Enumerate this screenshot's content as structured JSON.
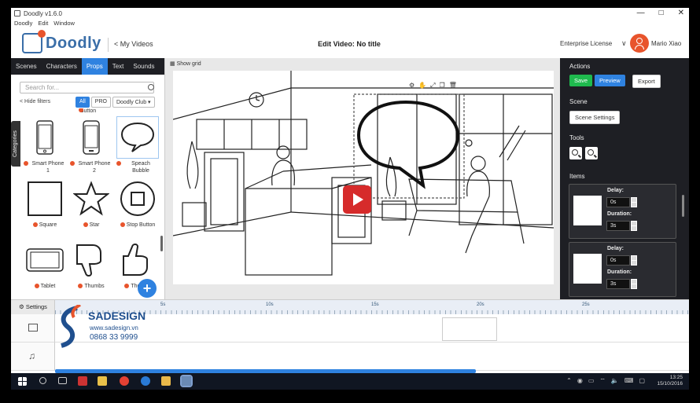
{
  "window": {
    "title": "Doodly v1.6.0",
    "controls": [
      "—",
      "□",
      "✕"
    ]
  },
  "menu": [
    "Doodly",
    "Edit",
    "Window"
  ],
  "header": {
    "logo": "Doodly",
    "back_link": "< My Videos",
    "edit_title": "Edit Video: No title",
    "license": "Enterprise License",
    "chevron": "∨",
    "user": "Mario Xiao"
  },
  "left": {
    "tabs": [
      "Scenes",
      "Characters",
      "Props",
      "Text",
      "Sounds"
    ],
    "active_tab": "Props",
    "search_placeholder": "Search for...",
    "hide_filters": "< Hide filters",
    "filters": [
      "All",
      "PRO",
      "Doodly Club ▾"
    ],
    "categories_label": "Categories",
    "top_partial": "Button",
    "props": [
      {
        "label": "Smart Phone 1",
        "icon": "smartphone-icon"
      },
      {
        "label": "Smart Phone 2",
        "icon": "smartphone-icon"
      },
      {
        "label": "Speach Bubble",
        "icon": "speech-bubble-icon"
      },
      {
        "label": "Square",
        "icon": "square-icon"
      },
      {
        "label": "Star",
        "icon": "star-icon"
      },
      {
        "label": "Stop Button",
        "icon": "stop-button-icon"
      },
      {
        "label": "Tablet",
        "icon": "tablet-icon"
      },
      {
        "label": "Thumbs",
        "icon": "thumbs-down-icon"
      },
      {
        "label": "Thumbs",
        "icon": "thumbs-up-icon"
      }
    ],
    "fab": "+"
  },
  "canvas": {
    "show_grid": "Show grid"
  },
  "right": {
    "actions_title": "Actions",
    "save": "Save",
    "preview": "Preview",
    "export": "Export",
    "scene_title": "Scene",
    "scene_settings": "Scene Settings",
    "tools_title": "Tools",
    "items_title": "Items",
    "items": [
      {
        "delay_label": "Delay:",
        "delay": "0s",
        "duration_label": "Duration:",
        "duration": "3s"
      },
      {
        "delay_label": "Delay:",
        "delay": "0s",
        "duration_label": "Duration:",
        "duration": "3s"
      }
    ]
  },
  "timeline": {
    "settings": "Settings",
    "ticks": [
      "5s",
      "10s",
      "15s",
      "20s",
      "25s"
    ]
  },
  "watermark": {
    "brand": "SADESIGN",
    "website": "www.sadesign.vn",
    "phone": "0868 33 9999"
  },
  "taskbar": {
    "time": "13:25",
    "date": "15/10/2016"
  },
  "colors": {
    "accent_blue": "#2f82e0",
    "save_green": "#1fba4e",
    "play_red": "#d62b2b",
    "brand_orange": "#e8542c",
    "panel_dark": "#1e1f24"
  }
}
